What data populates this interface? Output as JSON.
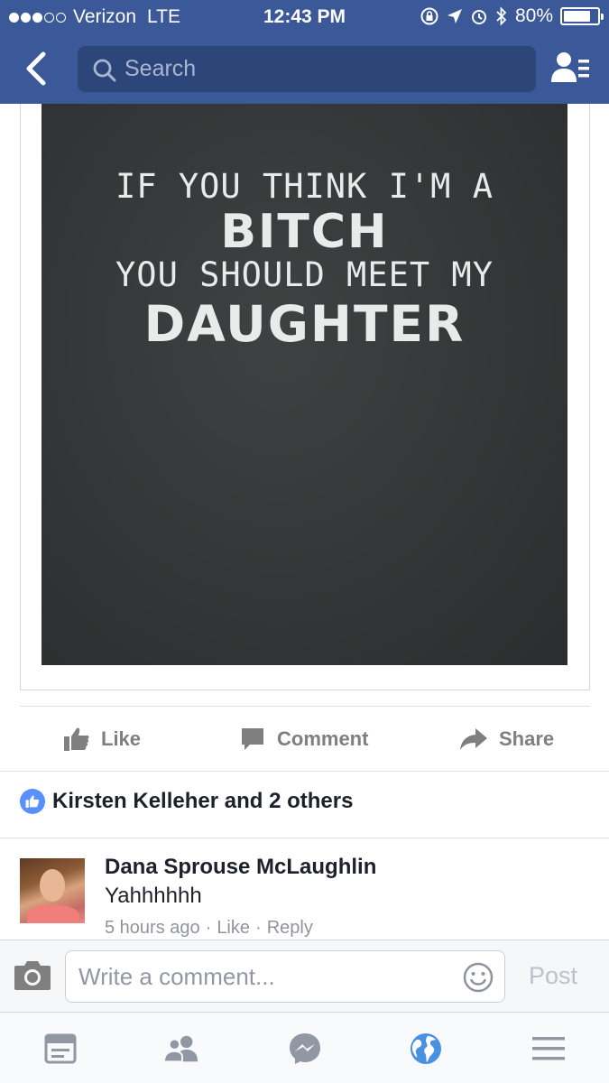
{
  "status_bar": {
    "carrier": "Verizon",
    "network": "LTE",
    "time": "12:43 PM",
    "battery": "80%",
    "battery_level": 0.8,
    "signal_bars": 3
  },
  "nav": {
    "search_placeholder": "Search"
  },
  "post_image": {
    "lines": [
      "IF YOU THINK I'M A",
      "BITCH",
      "YOU SHOULD MEET MY",
      "DAUGHTER"
    ]
  },
  "actions": {
    "like": "Like",
    "comment": "Comment",
    "share": "Share"
  },
  "likes": {
    "summary": "Kirsten Kelleher and 2 others"
  },
  "comment": {
    "author": "Dana Sprouse McLaughlin",
    "text": "Yahhhhhh",
    "time": "5 hours ago",
    "like": "Like",
    "reply": "Reply",
    "separator": "·"
  },
  "composer": {
    "placeholder": "Write a comment...",
    "post_label": "Post"
  },
  "colors": {
    "brand": "#3b5998",
    "like_blue": "#5890ff",
    "globe_blue": "#4a90e2"
  }
}
